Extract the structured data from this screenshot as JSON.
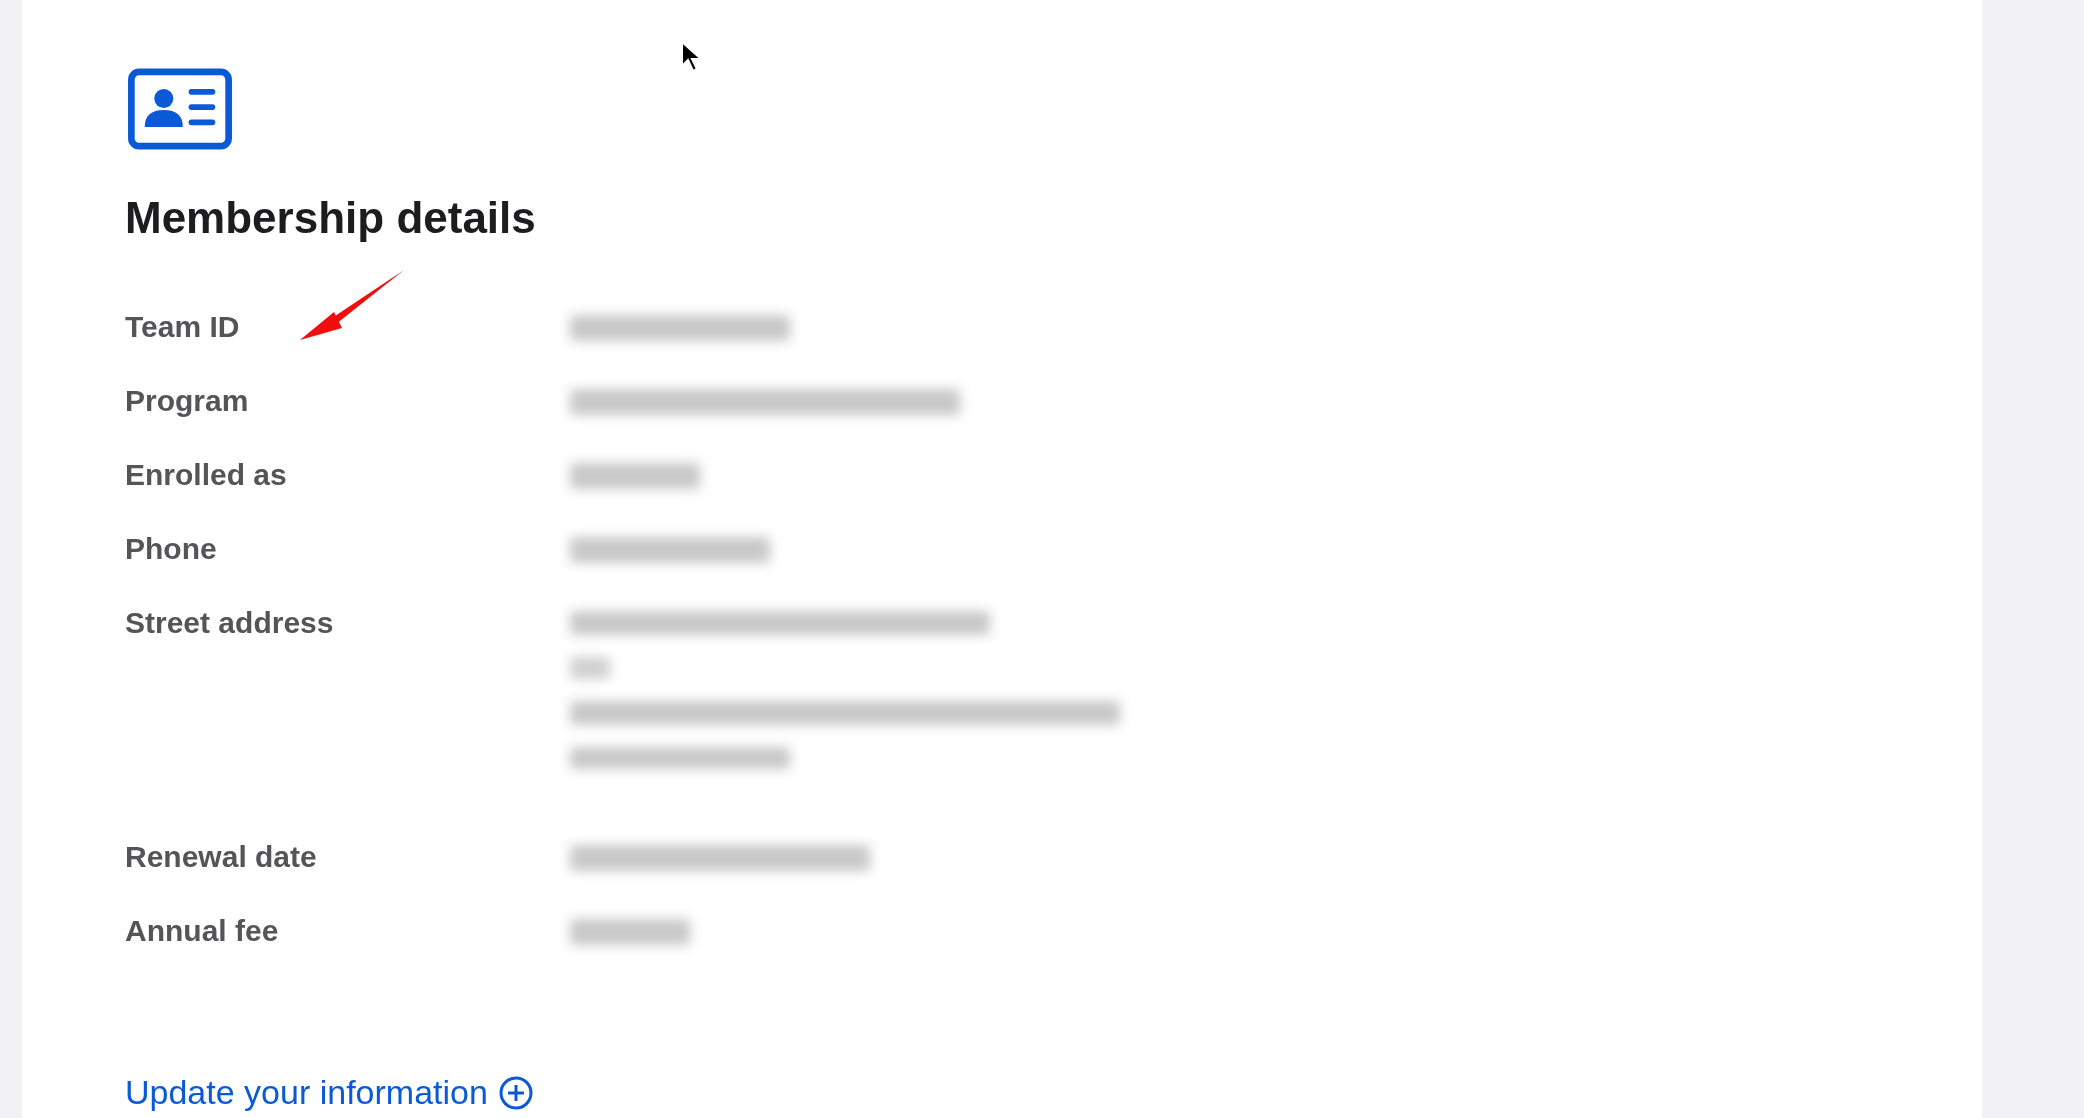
{
  "card": {
    "heading": "Membership details",
    "rows": [
      {
        "label": "Team ID",
        "kind": "redacted"
      },
      {
        "label": "Program",
        "kind": "redacted"
      },
      {
        "label": "Enrolled as",
        "kind": "redacted"
      },
      {
        "label": "Phone",
        "kind": "redacted"
      },
      {
        "label": "Street address",
        "kind": "redacted_multiline"
      },
      {
        "label": "Renewal date",
        "kind": "redacted"
      },
      {
        "label": "Annual fee",
        "kind": "redacted"
      }
    ],
    "link": {
      "label": "Update your information"
    }
  }
}
